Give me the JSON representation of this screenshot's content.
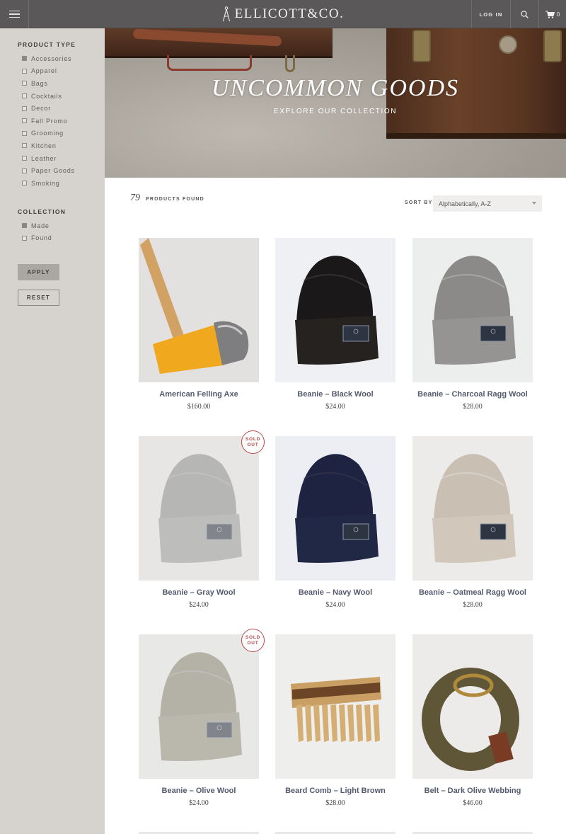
{
  "header": {
    "brand": "ELLICOTT&CO.",
    "login_label": "LOG IN",
    "cart_count": "0",
    "icons": [
      "menu-icon",
      "search-icon",
      "cart-icon",
      "compass-logo-icon"
    ]
  },
  "sidebar": {
    "product_type": {
      "title": "PRODUCT TYPE",
      "items": [
        {
          "label": "Accessories",
          "checked": true
        },
        {
          "label": "Apparel",
          "checked": false
        },
        {
          "label": "Bags",
          "checked": false
        },
        {
          "label": "Cocktails",
          "checked": false
        },
        {
          "label": "Decor",
          "checked": false
        },
        {
          "label": "Fall Promo",
          "checked": false
        },
        {
          "label": "Grooming",
          "checked": false
        },
        {
          "label": "Kitchen",
          "checked": false
        },
        {
          "label": "Leather",
          "checked": false
        },
        {
          "label": "Paper Goods",
          "checked": false
        },
        {
          "label": "Smoking",
          "checked": false
        }
      ]
    },
    "collection": {
      "title": "COLLECTION",
      "items": [
        {
          "label": "Made",
          "checked": true
        },
        {
          "label": "Found",
          "checked": false
        }
      ]
    },
    "apply_label": "APPLY",
    "reset_label": "RESET"
  },
  "hero": {
    "title": "UNCOMMON GOODS",
    "subtitle": "EXPLORE OUR COLLECTION"
  },
  "toolbar": {
    "count": "79",
    "count_label": "PRODUCTS FOUND",
    "sort_label": "SORT BY",
    "sort_value": "Alphabetically, A-Z"
  },
  "products": [
    {
      "name": "American Felling Axe",
      "price": "$160.00",
      "sold_out": false
    },
    {
      "name": "Beanie – Black Wool",
      "price": "$24.00",
      "sold_out": false
    },
    {
      "name": "Beanie – Charcoal Ragg Wool",
      "price": "$28.00",
      "sold_out": false
    },
    {
      "name": "Beanie – Gray Wool",
      "price": "$24.00",
      "sold_out": true
    },
    {
      "name": "Beanie – Navy Wool",
      "price": "$24.00",
      "sold_out": false
    },
    {
      "name": "Beanie – Oatmeal Ragg Wool",
      "price": "$28.00",
      "sold_out": false
    },
    {
      "name": "Beanie – Olive Wool",
      "price": "$24.00",
      "sold_out": true
    },
    {
      "name": "Beard Comb – Light Brown",
      "price": "$28.00",
      "sold_out": false
    },
    {
      "name": "Belt – Dark Olive Webbing",
      "price": "$46.00",
      "sold_out": false
    }
  ],
  "sold_out_label": [
    "SOLD",
    "OUT"
  ],
  "colors": {
    "header_bg": "#5a5859",
    "sidebar_bg": "#d6d3cf",
    "product_name": "#555b6e",
    "sold_out": "#b54a4a"
  }
}
